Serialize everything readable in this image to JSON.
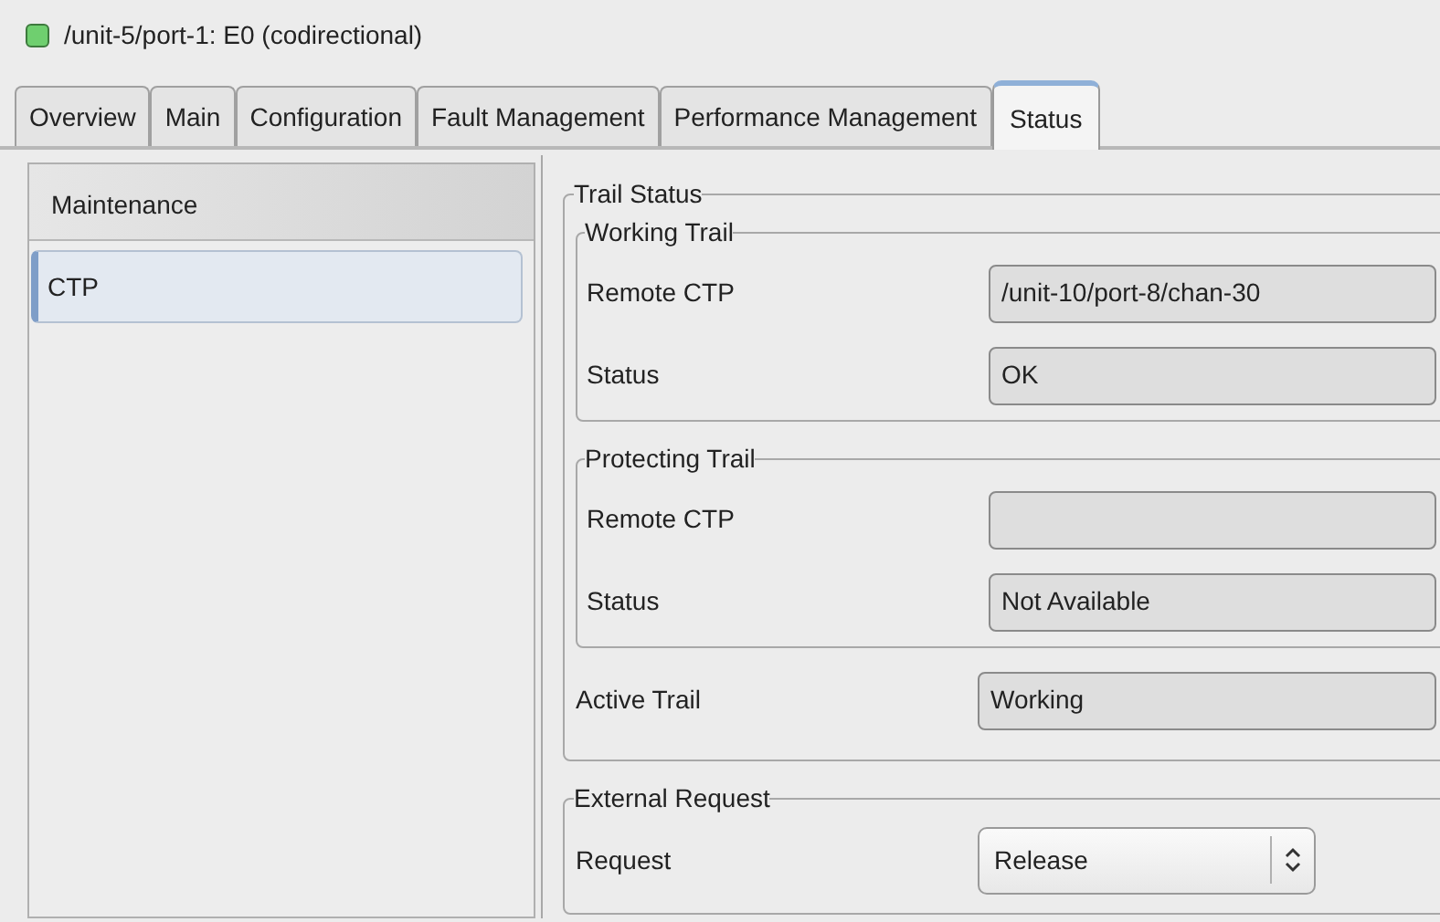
{
  "window": {
    "title": "/unit-5/port-1: E0 (codirectional)"
  },
  "tabs": [
    {
      "label": "Overview",
      "selected": false
    },
    {
      "label": "Main",
      "selected": false
    },
    {
      "label": "Configuration",
      "selected": false
    },
    {
      "label": "Fault Management",
      "selected": false
    },
    {
      "label": "Performance Management",
      "selected": false
    },
    {
      "label": "Status",
      "selected": true
    }
  ],
  "sidebar": {
    "items": [
      {
        "label": "Maintenance",
        "selected": false
      },
      {
        "label": "CTP",
        "selected": true
      }
    ]
  },
  "trail_status": {
    "title": "Trail Status",
    "groups": [
      {
        "title": "Working Trail",
        "fields": [
          {
            "label": "Remote CTP",
            "value": "/unit-10/port-8/chan-30"
          },
          {
            "label": "Status",
            "value": "OK"
          }
        ]
      },
      {
        "title": "Protecting Trail",
        "fields": [
          {
            "label": "Remote CTP"
          },
          {
            "label": "Status",
            "value": "Not Available"
          }
        ]
      }
    ],
    "active_trail": {
      "label": "Active Trail",
      "value": "Working"
    }
  },
  "external_request": {
    "title": "External Request",
    "request": {
      "label": "Request",
      "value": "Release"
    }
  }
}
